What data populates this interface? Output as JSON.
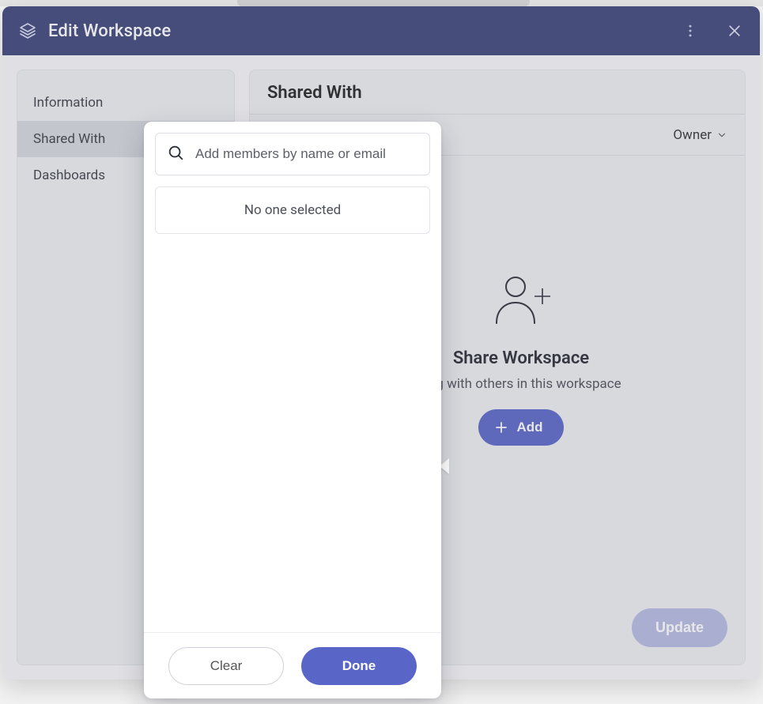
{
  "header": {
    "title": "Edit Workspace"
  },
  "sidebar": {
    "items": [
      {
        "label": "Information"
      },
      {
        "label": "Shared With"
      },
      {
        "label": "Dashboards"
      }
    ],
    "active_index": 1
  },
  "panel": {
    "title": "Shared With",
    "tab_label": "",
    "role": "Owner",
    "empty": {
      "title": "Share Workspace",
      "subtitle": "ting with others in this workspace",
      "add_label": "Add"
    },
    "update_label": "Update"
  },
  "popover": {
    "search_placeholder": "Add members by name or email",
    "empty_selection": "No one selected",
    "clear_label": "Clear",
    "done_label": "Done"
  },
  "colors": {
    "header_bg": "#3b4479",
    "primary": "#5a66c7"
  }
}
